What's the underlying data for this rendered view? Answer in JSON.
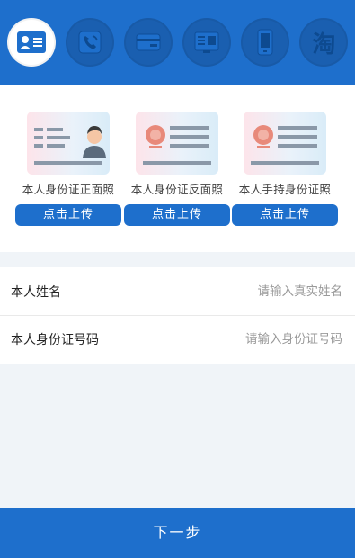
{
  "tabs": [
    {
      "icon": "id-card-icon",
      "active": true
    },
    {
      "icon": "phone-icon",
      "active": false
    },
    {
      "icon": "bank-card-icon",
      "active": false
    },
    {
      "icon": "credit-report-icon",
      "active": false
    },
    {
      "icon": "mobile-icon",
      "active": false
    },
    {
      "icon": "taobao-icon",
      "active": false,
      "glyph": "淘"
    }
  ],
  "upload": {
    "cards": [
      {
        "caption": "本人身份证正面照",
        "button": "点击上传",
        "icon": "id-front-icon"
      },
      {
        "caption": "本人身份证反面照",
        "button": "点击上传",
        "icon": "id-back-icon"
      },
      {
        "caption": "本人手持身份证照",
        "button": "点击上传",
        "icon": "id-handheld-icon"
      }
    ]
  },
  "form": {
    "name_label": "本人姓名",
    "name_placeholder": "请输入真实姓名",
    "id_label": "本人身份证号码",
    "id_placeholder": "请输入身份证号码"
  },
  "next_button": "下一步",
  "colors": {
    "primary": "#1e6fcc",
    "tab_bg": "#1a5fb0",
    "background": "#f0f4f8"
  }
}
